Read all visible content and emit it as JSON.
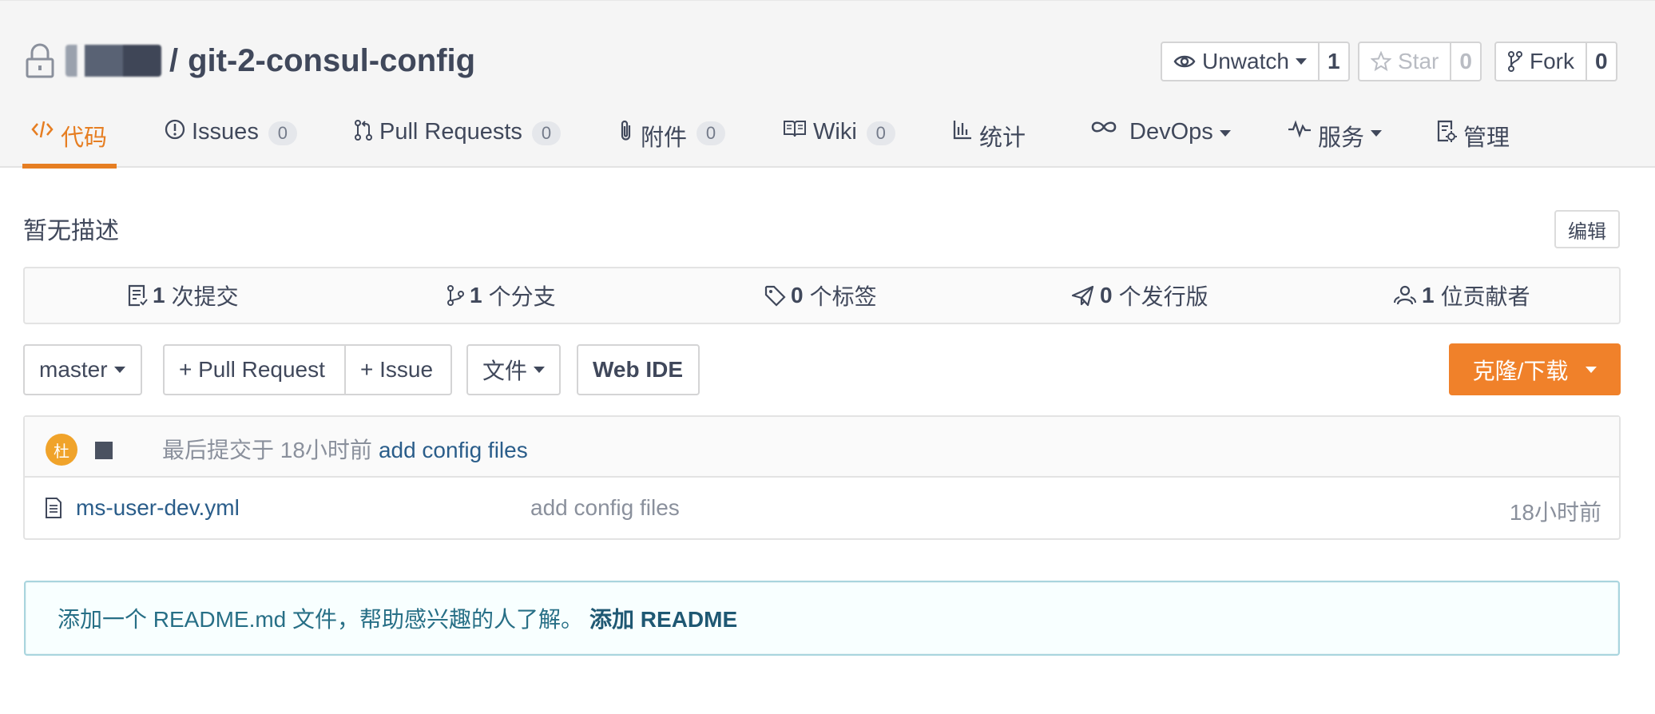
{
  "repo": {
    "name": "git-2-consul-config",
    "separator": "/"
  },
  "header_actions": {
    "watch": {
      "label": "Unwatch",
      "count": "1"
    },
    "star": {
      "label": "Star",
      "count": "0"
    },
    "fork": {
      "label": "Fork",
      "count": "0"
    }
  },
  "tabs": [
    {
      "label": "代码",
      "icon": "code-icon",
      "active": true
    },
    {
      "label": "Issues",
      "badge": "0",
      "icon": "issue-icon"
    },
    {
      "label": "Pull Requests",
      "badge": "0",
      "icon": "pull-request-icon"
    },
    {
      "label": "附件",
      "badge": "0",
      "icon": "paperclip-icon"
    },
    {
      "label": "Wiki",
      "badge": "0",
      "icon": "book-icon"
    },
    {
      "label": "统计",
      "icon": "bar-chart-icon"
    },
    {
      "label": "DevOps",
      "icon": "infinity-icon",
      "dropdown": true
    },
    {
      "label": "服务",
      "icon": "pulse-icon",
      "dropdown": true
    },
    {
      "label": "管理",
      "icon": "settings-doc-icon"
    }
  ],
  "description": "暂无描述",
  "edit_label": "编辑",
  "stats": [
    {
      "count": "1",
      "label": "次提交",
      "icon": "commit-icon"
    },
    {
      "count": "1",
      "label": "个分支",
      "icon": "branch-icon"
    },
    {
      "count": "0",
      "label": "个标签",
      "icon": "tag-icon"
    },
    {
      "count": "0",
      "label": "个发行版",
      "icon": "send-icon"
    },
    {
      "count": "1",
      "label": "位贡献者",
      "icon": "contributors-icon"
    }
  ],
  "toolbar": {
    "branch": "master",
    "new_pr": "+ Pull Request",
    "new_issue": "+ Issue",
    "file": "文件",
    "web_ide": "Web IDE",
    "clone": "克隆/下载"
  },
  "last_commit": {
    "avatar_text": "杜",
    "prefix": "最后提交于 18小时前",
    "message": "add config files"
  },
  "files": [
    {
      "name": "ms-user-dev.yml",
      "commit": "add config files",
      "time": "18小时前"
    }
  ],
  "readme_notice": {
    "text": "添加一个 README.md 文件，帮助感兴趣的人了解。",
    "link": "添加 README"
  },
  "colors": {
    "accent": "#e67e22",
    "clone_button": "#f0812a",
    "link": "#2a5d8a",
    "avatar": "#f0a32a"
  }
}
